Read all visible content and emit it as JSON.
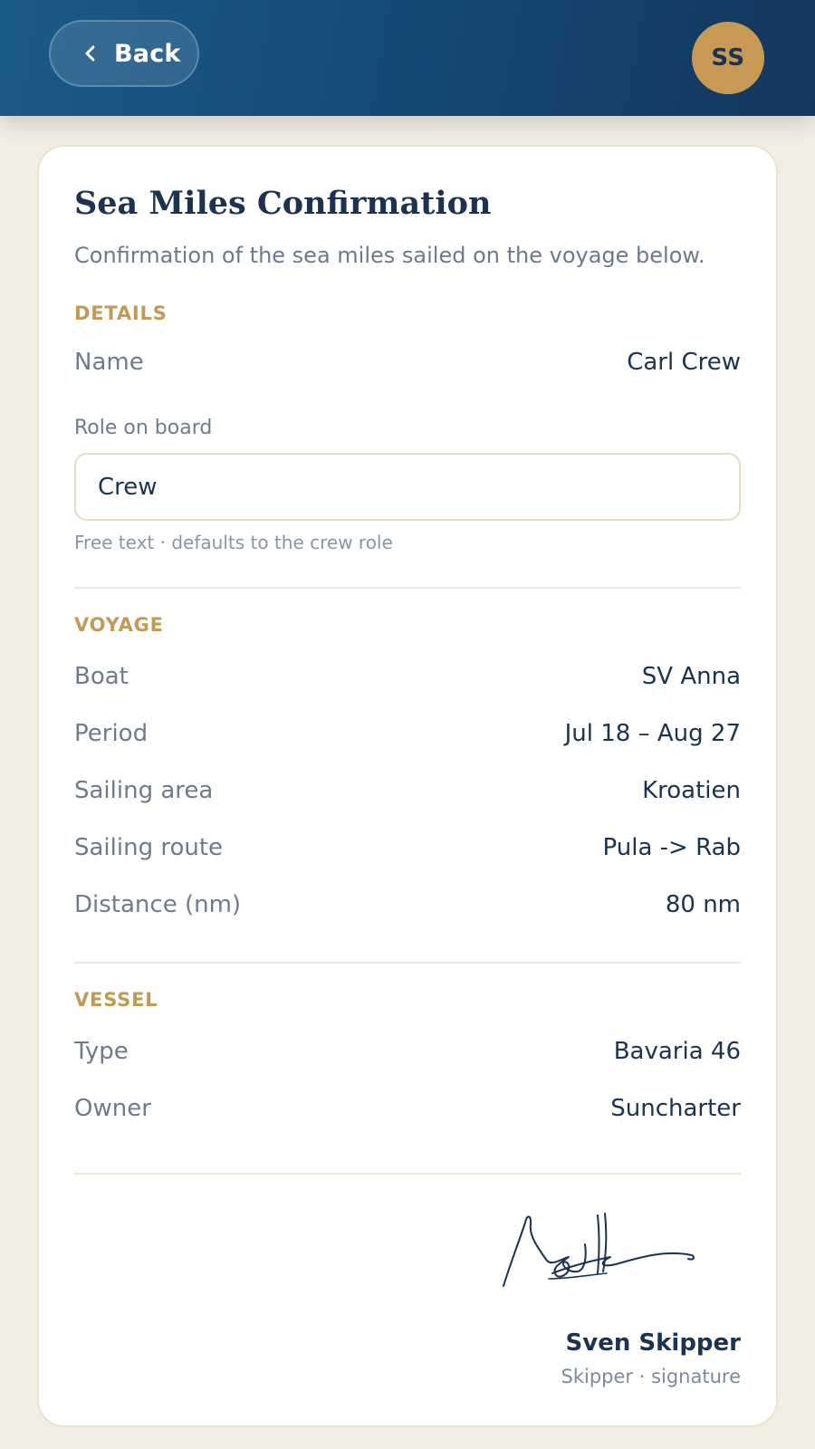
{
  "header": {
    "back_label": "Back",
    "avatar_initials": "SS",
    "accent_color": "#c99a55"
  },
  "card": {
    "title": "Sea Miles Confirmation",
    "subtitle": "Confirmation of the sea miles sailed on the voyage below.",
    "details": {
      "section_label": "DETAILS",
      "name_label": "Name",
      "name_value": "Carl Crew",
      "role_label": "Role on board",
      "role_value": "Crew",
      "role_helper": "Free text · defaults to the crew role"
    },
    "voyage": {
      "section_label": "VOYAGE",
      "rows": [
        {
          "label": "Boat",
          "value": "SV Anna"
        },
        {
          "label": "Period",
          "value": "Jul 18 – Aug 27"
        },
        {
          "label": "Sailing area",
          "value": "Kroatien"
        },
        {
          "label": "Sailing route",
          "value": "Pula -> Rab"
        },
        {
          "label": "Distance (nm)",
          "value": "80 nm"
        }
      ]
    },
    "vessel": {
      "section_label": "VESSEL",
      "rows": [
        {
          "label": "Type",
          "value": "Bavaria 46"
        },
        {
          "label": "Owner",
          "value": "Suncharter"
        }
      ]
    },
    "signature": {
      "name": "Sven Skipper",
      "caption": "Skipper · signature"
    }
  }
}
